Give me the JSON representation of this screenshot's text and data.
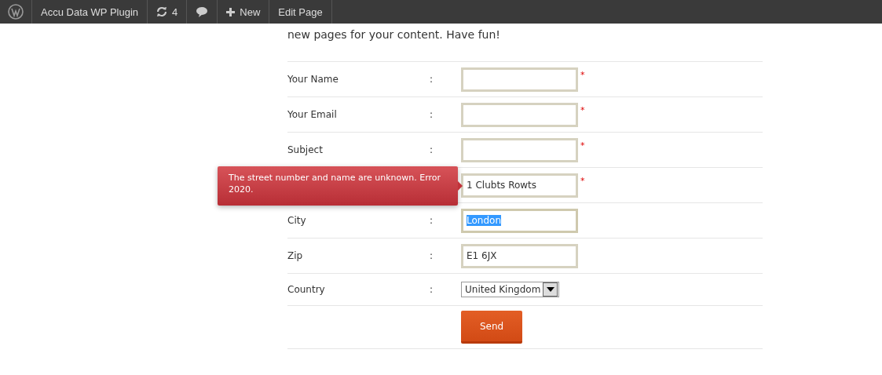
{
  "admin_bar": {
    "items": [
      {
        "kind": "logo"
      },
      {
        "kind": "text",
        "label": "Accu Data WP Plugin"
      },
      {
        "kind": "updates",
        "label": "4"
      },
      {
        "kind": "comments"
      },
      {
        "kind": "new",
        "label": "New"
      },
      {
        "kind": "text",
        "label": "Edit Page"
      }
    ]
  },
  "intro": "new pages for your content. Have fun!",
  "form": {
    "fields": [
      {
        "label": "Your Name",
        "kind": "text",
        "required": true,
        "highlighted": false
      },
      {
        "label": "Your Email",
        "kind": "text",
        "required": true,
        "highlighted": false
      },
      {
        "label": "Subject",
        "kind": "text",
        "required": true,
        "highlighted": false
      },
      {
        "kind": "text",
        "value": "1 Clubts Rowts",
        "required": true,
        "highlighted": false,
        "error": "The street number and name are unknown. Error 2020."
      },
      {
        "label": "City",
        "kind": "text",
        "value": "London",
        "required": false,
        "highlighted": true
      },
      {
        "label": "Zip",
        "kind": "text",
        "value": "E1 6JX",
        "required": false,
        "highlighted": false
      },
      {
        "label": "Country",
        "kind": "select",
        "value": "United Kingdom",
        "required": false,
        "highlighted": false
      }
    ],
    "separator": ":",
    "required_mark": "*",
    "submit": "Send"
  }
}
